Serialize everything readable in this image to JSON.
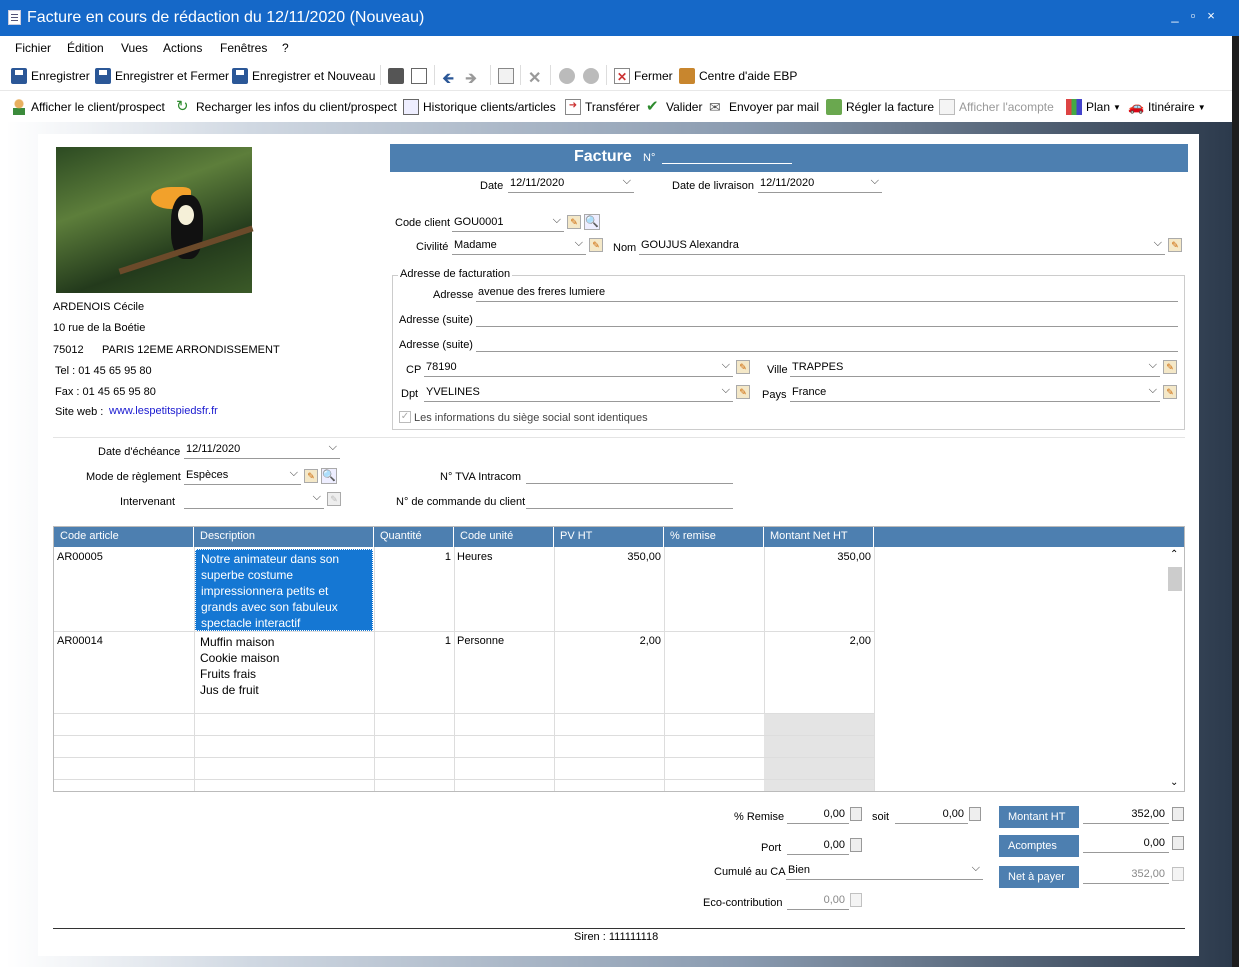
{
  "window": {
    "title": "Facture en cours de rédaction du 12/11/2020 (Nouveau)",
    "controls": [
      "_",
      "▫",
      "×"
    ]
  },
  "menu": [
    "Fichier",
    "Édition",
    "Vues",
    "Actions",
    "Fenêtres",
    "?"
  ],
  "toolbar1": {
    "save": "Enregistrer",
    "save_close": "Enregistrer et Fermer",
    "save_new": "Enregistrer et Nouveau",
    "close": "Fermer",
    "help": "Centre d'aide EBP"
  },
  "toolbar2": {
    "show_client": "Afficher le client/prospect",
    "reload": "Recharger les infos du client/prospect",
    "history": "Historique clients/articles",
    "transfer": "Transférer",
    "validate": "Valider",
    "email": "Envoyer par mail",
    "pay": "Régler la facture",
    "deposit": "Afficher l'acompte",
    "plan": "Plan",
    "route": "Itinéraire"
  },
  "company": {
    "name": "ARDENOIS Cécile",
    "street": "10 rue de la Boétie",
    "zip": "75012",
    "city": "PARIS 12EME ARRONDISSEMENT",
    "tel": "Tel :  01 45 65 95 80",
    "fax": "Fax :  01 45 65 95 80",
    "web_label": "Site web :",
    "web": "www.lespetitspiedsfr.fr"
  },
  "invoice": {
    "title": "Facture",
    "no_label": "N°",
    "date_label": "Date",
    "date": "12/11/2020",
    "delivery_label": "Date de livraison",
    "delivery": "12/11/2020"
  },
  "client": {
    "code_label": "Code client",
    "code": "GOU0001",
    "civ_label": "Civilité",
    "civ": "Madame",
    "name_label": "Nom",
    "name": "GOUJUS Alexandra"
  },
  "billing": {
    "legend": "Adresse de facturation",
    "addr_label": "Adresse",
    "addr": "avenue des freres lumiere",
    "addr2_label": "Adresse (suite)",
    "addr2": "",
    "addr3_label": "Adresse (suite)",
    "addr3": "",
    "cp_label": "CP",
    "cp": "78190",
    "ville_label": "Ville",
    "ville": "TRAPPES",
    "dpt_label": "Dpt",
    "dpt": "YVELINES",
    "pays_label": "Pays",
    "pays": "France",
    "same_label": "Les informations du siège social sont identiques"
  },
  "payment": {
    "due_label": "Date d'échéance",
    "due": "12/11/2020",
    "mode_label": "Mode de règlement",
    "mode": "Espèces",
    "agent_label": "Intervenant",
    "agent": "",
    "tva_label": "N° TVA Intracom",
    "tva": "",
    "order_label": "N° de commande du client",
    "order": ""
  },
  "grid": {
    "headers": [
      "Code article",
      "Description",
      "Quantité",
      "Code unité",
      "PV HT",
      "% remise",
      "Montant Net HT"
    ],
    "rows": [
      {
        "code": "AR00005",
        "desc": [
          "Notre animateur dans son",
          "superbe costume",
          "impressionnera petits et",
          "grands avec son fabuleux",
          "spectacle interactif"
        ],
        "qty": "1",
        "unit": "Heures",
        "pv": "350,00",
        "remise": "",
        "net": "350,00"
      },
      {
        "code": "AR00014",
        "desc": [
          "Muffin maison",
          "Cookie maison",
          "Fruits frais",
          "Jus de fruit"
        ],
        "qty": "1",
        "unit": "Personne",
        "pv": "2,00",
        "remise": "",
        "net": "2,00"
      }
    ]
  },
  "totals": {
    "remise_label": "% Remise",
    "remise": "0,00",
    "soit_label": "soit",
    "soit": "0,00",
    "port_label": "Port",
    "port": "0,00",
    "ca_label": "Cumulé au CA",
    "ca": "Bien",
    "eco_label": "Eco-contribution",
    "eco": "0,00",
    "ht_label": "Montant HT",
    "ht": "352,00",
    "acomptes_label": "Acomptes",
    "acomptes": "0,00",
    "net_label": "Net à payer",
    "net": "352,00"
  },
  "footer": {
    "siren": "Siren : 111111118"
  }
}
